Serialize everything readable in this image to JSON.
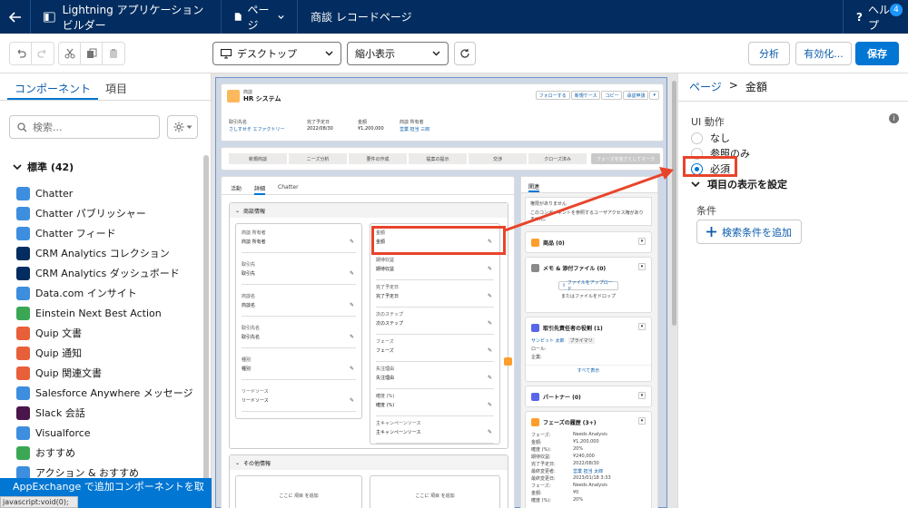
{
  "topbar": {
    "app_title": "Lightning アプリケーションビルダー",
    "page_menu": "ページ",
    "record_page": "商談 レコードページ",
    "help": "ヘルプ",
    "help_badge": "4"
  },
  "toolbar": {
    "device": "デスクトップ",
    "zoom": "縮小表示",
    "analyze": "分析",
    "activate": "有効化...",
    "save": "保存"
  },
  "sidebar": {
    "tabs": [
      "コンポーネント",
      "項目"
    ],
    "search_placeholder": "検索...",
    "section_label": "標準 (42)",
    "items": [
      {
        "label": "Chatter",
        "icon": "chatter-icon",
        "color": "#3e8edf"
      },
      {
        "label": "Chatter パブリッシャー",
        "icon": "lightning-bolt-icon",
        "color": "#3e8edf"
      },
      {
        "label": "Chatter フィード",
        "icon": "feed-icon",
        "color": "#3e8edf"
      },
      {
        "label": "CRM Analytics コレクション",
        "icon": "bar-chart-icon",
        "color": "#032d60"
      },
      {
        "label": "CRM Analytics ダッシュボード",
        "icon": "bar-chart-icon",
        "color": "#032d60"
      },
      {
        "label": "Data.com インサイト",
        "icon": "data-d-icon",
        "color": "#3e8edf"
      },
      {
        "label": "Einstein Next Best Action",
        "icon": "einstein-icon",
        "color": "#3ba755"
      },
      {
        "label": "Quip 文書",
        "icon": "quip-icon",
        "color": "#e8603a"
      },
      {
        "label": "Quip 通知",
        "icon": "quip-icon",
        "color": "#e8603a"
      },
      {
        "label": "Quip 関連文書",
        "icon": "quip-icon",
        "color": "#e8603a"
      },
      {
        "label": "Salesforce Anywhere メッセージ",
        "icon": "chat-icon",
        "color": "#3e8edf"
      },
      {
        "label": "Slack 会話",
        "icon": "slack-icon",
        "color": "#4a154b"
      },
      {
        "label": "Visualforce",
        "icon": "visualforce-icon",
        "color": "#3e8edf"
      },
      {
        "label": "おすすめ",
        "icon": "lightbulb-icon",
        "color": "#3ba755"
      },
      {
        "label": "アクション & おすすめ",
        "icon": "list-icon",
        "color": "#3e8edf"
      }
    ],
    "appexchange": "AppExchange で追加コンポーネントを取得",
    "statusbar": "javascript:void(0);"
  },
  "canvas": {
    "header": {
      "object": "商談",
      "title": "HR システム",
      "buttons": [
        "フォローする",
        "新規ケース",
        "コピー",
        "承認申請"
      ],
      "fields": [
        {
          "label": "取引先名",
          "value": "さしすせそ エファクトリー",
          "link": true
        },
        {
          "label": "完了予定日",
          "value": "2022/08/30"
        },
        {
          "label": "金額",
          "value": "¥1,200,000"
        },
        {
          "label": "商談 所有者",
          "value": "営業 担当 三郎",
          "link": true
        }
      ]
    },
    "path": {
      "steps": [
        "新規商談",
        "ニーズ分析",
        "要件の作成",
        "提案の提示",
        "交渉",
        "クローズ済み"
      ],
      "complete": "フェーズを完了としてマーク"
    },
    "tabs": [
      "活動",
      "詳細",
      "Chatter"
    ],
    "section_title": "商談情報",
    "left_fields": [
      [
        "商談 所有者",
        "商談 所有者"
      ],
      [
        "取引先",
        "取引先"
      ],
      [
        "商談名",
        "商談名"
      ],
      [
        "取引先名",
        "取引先名"
      ],
      [
        "種別",
        "種別"
      ],
      [
        "リードソース",
        "リードソース"
      ]
    ],
    "right_fields": [
      [
        "金額",
        "金額"
      ],
      [
        "期待収益",
        "期待収益"
      ],
      [
        "完了予定日",
        "完了予定日"
      ],
      [
        "次のステップ",
        "次のステップ"
      ],
      [
        "フェーズ",
        "フェーズ"
      ],
      [
        "失注理由",
        "失注理由"
      ],
      [
        "確度 (%)",
        "確度 (%)"
      ],
      [
        "主キャンペーンソース",
        "主キャンペーンソース"
      ]
    ],
    "other_section": "その他情報",
    "add_here": "ここに 項目 を追加",
    "related": {
      "tab": "関連",
      "notice_title": "権限がありません",
      "notice_text": "このコンポーネントを参照するユーザアクセス権がありません。",
      "cards": [
        {
          "title": "商品 (0)",
          "color": "#ff9e2c"
        },
        {
          "title": "メモ & 添付ファイル (0)",
          "color": "#8a8a8a",
          "upload": "ファイルをアップロード",
          "drop": "またはファイルをドロップ"
        },
        {
          "title": "取引先責任者の役割 (1)",
          "color": "#5867e8",
          "contact": "サンビット 太郎",
          "primary": "プライマリ",
          "role": "ロール:",
          "email": "企業:",
          "view_all": "すべて表示"
        },
        {
          "title": "パートナー (0)",
          "color": "#5867e8"
        },
        {
          "title": "フェーズの履歴 (3+)",
          "color": "#ff9e2c",
          "history": [
            [
              "フェーズ:",
              "Needs Analysis"
            ],
            [
              "金額:",
              "¥1,200,000"
            ],
            [
              "確度 (%):",
              "20%"
            ],
            [
              "期待収益:",
              "¥240,000"
            ],
            [
              "完了予定日:",
              "2022/08/30"
            ],
            [
              "最終変更者:",
              "営業 担当 太郎"
            ],
            [
              "最終変更日:",
              "2023/01/18 3:33"
            ],
            [
              "フェーズ:",
              "Needs Analysis"
            ],
            [
              "金額:",
              "¥0"
            ],
            [
              "確度 (%):",
              "20%"
            ]
          ]
        }
      ]
    }
  },
  "props": {
    "breadcrumb_page": "ページ",
    "breadcrumb_sep": ">",
    "breadcrumb_current": "金額",
    "ui_action_label": "UI 動作",
    "options": [
      "なし",
      "参照のみ",
      "必須"
    ],
    "visibility_label": "項目の表示を設定",
    "condition_label": "条件",
    "add_filter": "検索条件を追加"
  },
  "colors": {
    "nav": "#032d60",
    "brand": "#0176d3",
    "highlight": "#e8442a"
  }
}
